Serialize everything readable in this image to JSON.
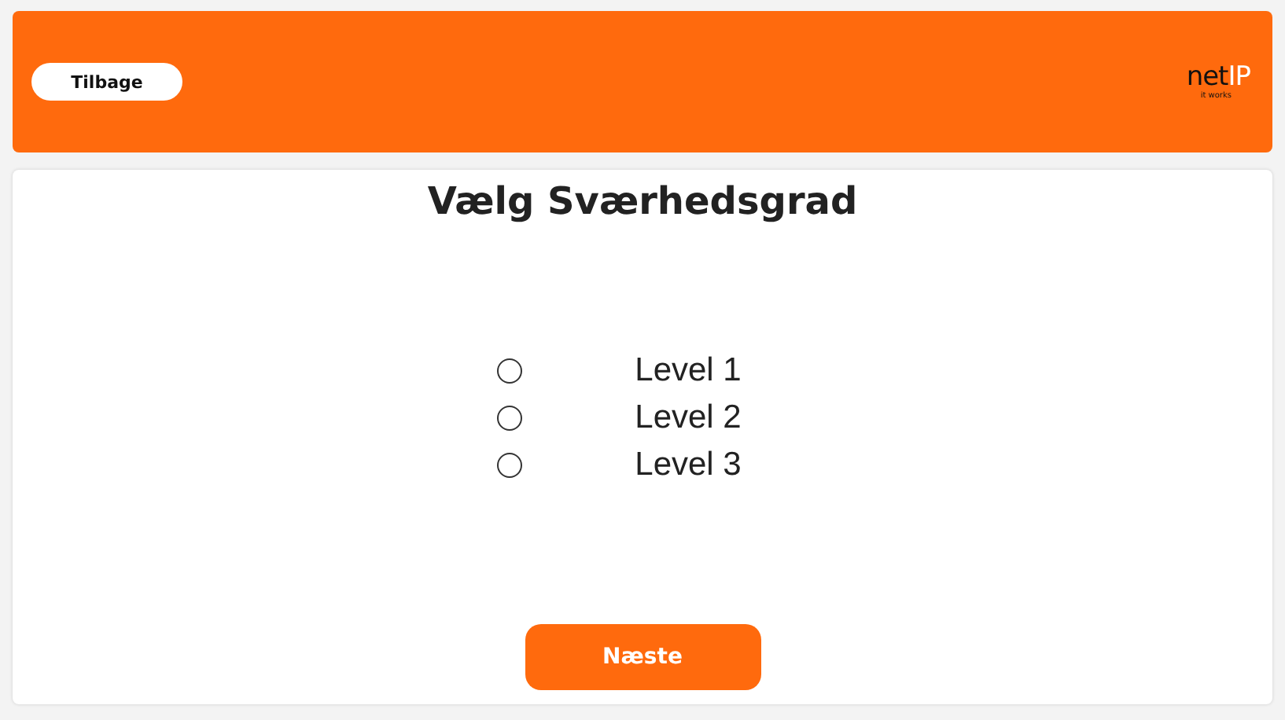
{
  "header": {
    "back_button": "Tilbage",
    "logo": {
      "part_dark": "net",
      "part_light": "IP",
      "tagline": "it works"
    }
  },
  "title": "Vælg Sværhedsgrad",
  "levels": [
    {
      "label": "Level 1",
      "selected": false
    },
    {
      "label": "Level 2",
      "selected": false
    },
    {
      "label": "Level 3",
      "selected": false
    }
  ],
  "next_button": "Næste"
}
